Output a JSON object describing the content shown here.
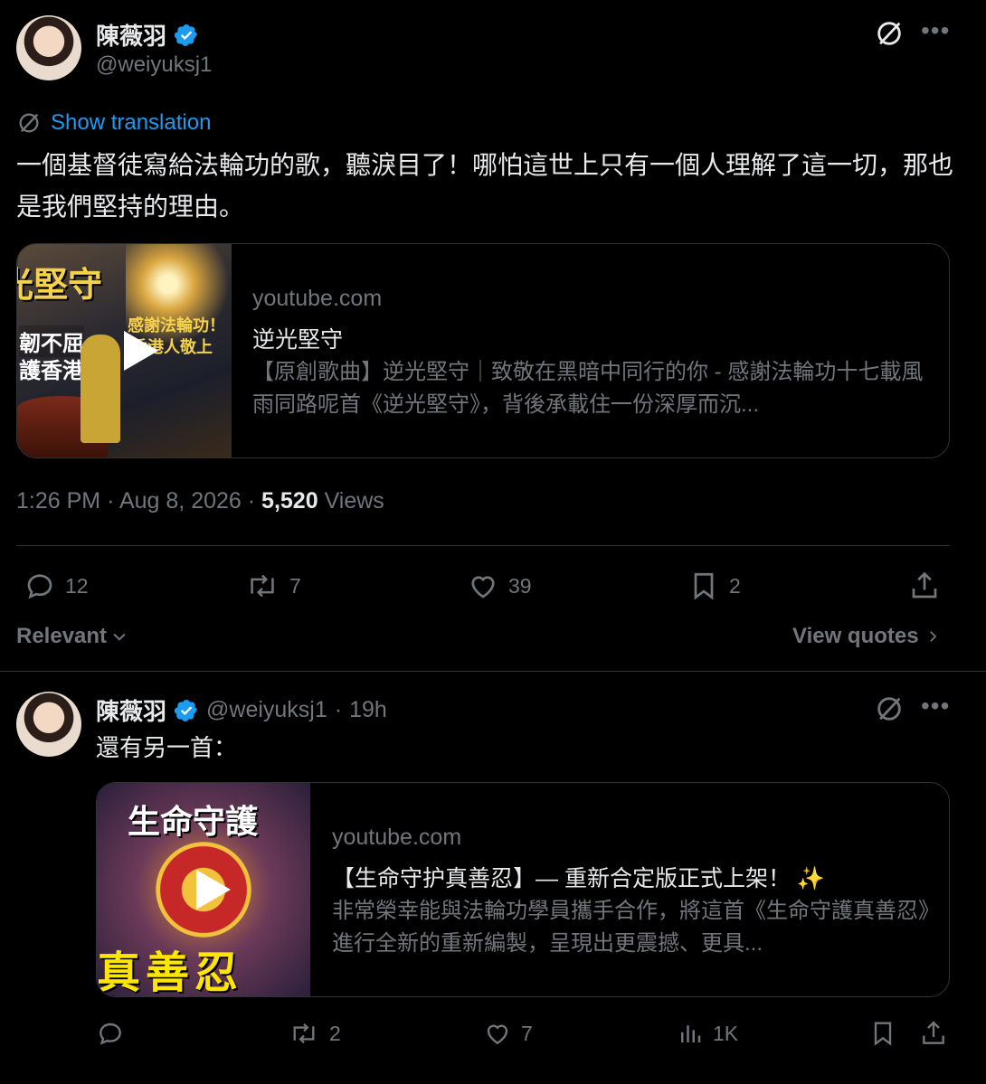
{
  "main_tweet": {
    "author_name": "陳薇羽",
    "author_handle": "@weiyuksj1",
    "show_translation": "Show translation",
    "text": "一個基督徒寫給法輪功的歌，聽淚目了！哪怕這世上只有一個人理解了這一切，那也是我們堅持的理由。",
    "card": {
      "domain": "youtube.com",
      "title": "逆光堅守",
      "description": "【原創歌曲】逆光堅守｜致敬在黑暗中同行的你 - 感謝法輪功十七載風雨同路呢首《逆光堅守》，背後承載住一份深厚而沉...",
      "thumb_text_1": "光堅守",
      "thumb_text_2": "韌不屈",
      "thumb_text_3": "護香港",
      "thumb_text_4": "感謝法輪功！",
      "thumb_text_5": "香港人敬上"
    },
    "time": "1:26 PM",
    "date": "Aug 8, 2026",
    "views_count": "5,520",
    "views_label": "Views",
    "replies": "12",
    "reposts": "7",
    "likes": "39",
    "bookmarks": "2"
  },
  "filter": {
    "relevant": "Relevant",
    "view_quotes": "View quotes"
  },
  "reply_tweet": {
    "author_name": "陳薇羽",
    "author_handle": "@weiyuksj1",
    "time_ago": "19h",
    "text": "還有另一首：",
    "card": {
      "domain": "youtube.com",
      "title": "【生命守护真善忍】— 重新合定版正式上架！ ✨",
      "description": "非常榮幸能與法輪功學員攜手合作，將這首《生命守護真善忍》進行全新的重新編製，呈現出更震撼、更具...",
      "thumb_top": "生命守護",
      "thumb_bottom": "真善忍"
    },
    "replies": "",
    "reposts": "2",
    "likes": "7",
    "views": "1K"
  },
  "colors": {
    "accent": "#1d9bf0",
    "muted": "#71767b",
    "border": "#2f3336",
    "text": "#e7e9ea"
  }
}
